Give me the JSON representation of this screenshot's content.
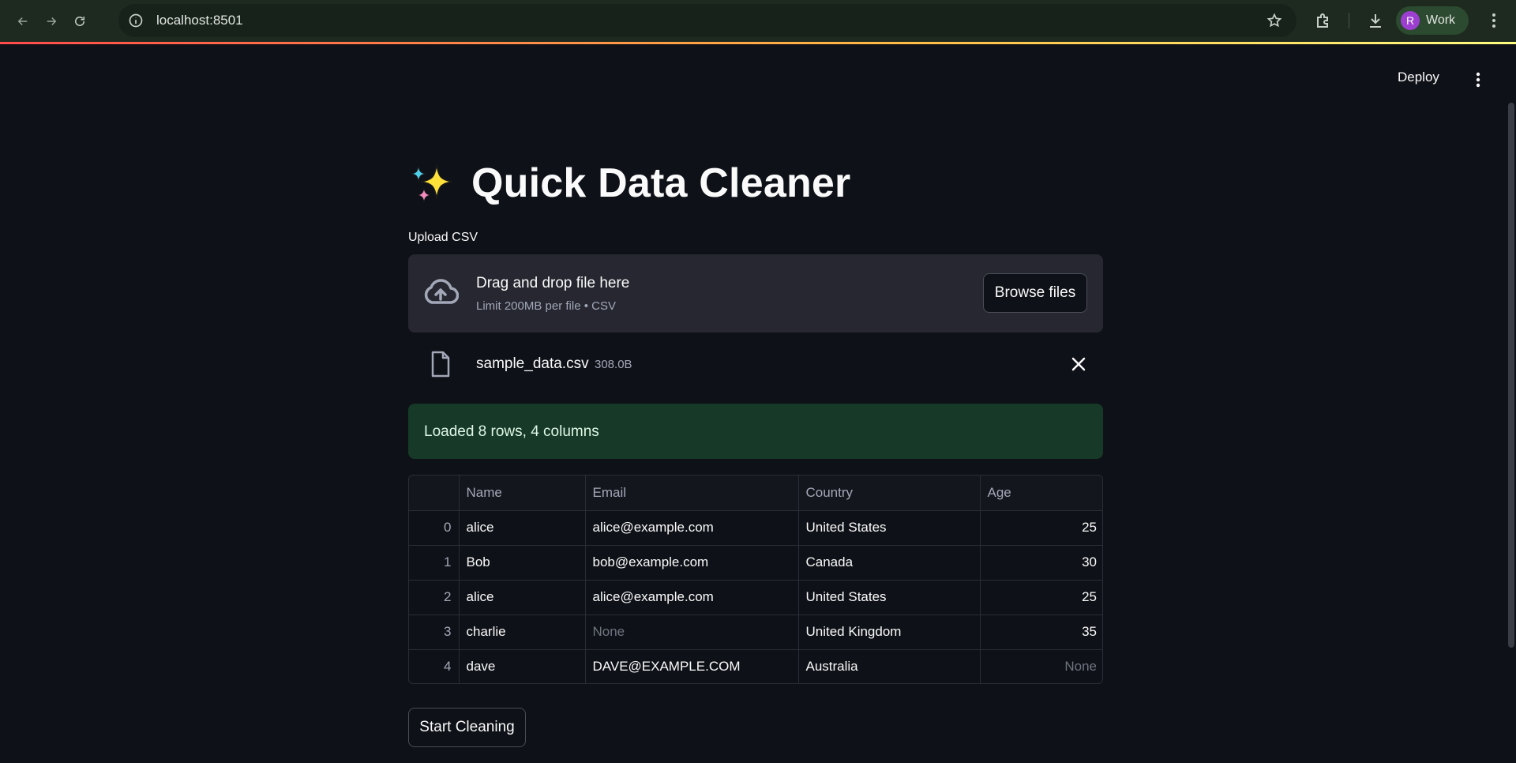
{
  "browser": {
    "url": "localhost:8501",
    "profile_initial": "R",
    "profile_label": "Work"
  },
  "app_header": {
    "deploy_label": "Deploy"
  },
  "title": {
    "text": "Quick Data Cleaner",
    "icon": "sparkles-emoji"
  },
  "uploader": {
    "label": "Upload CSV",
    "drop_text": "Drag and drop file here",
    "limit_text": "Limit 200MB per file • CSV",
    "browse_label": "Browse files",
    "file_name": "sample_data.csv",
    "file_size": "308.0B"
  },
  "status": {
    "message": "Loaded 8 rows, 4 columns",
    "color": "#173928"
  },
  "table": {
    "columns": [
      "",
      "Name",
      "Email",
      "Country",
      "Age"
    ],
    "rows": [
      {
        "index": "0",
        "name": "alice",
        "email": "alice@example.com",
        "country": "United States",
        "age": "25"
      },
      {
        "index": "1",
        "name": "Bob",
        "email": "bob@example.com",
        "country": "Canada",
        "age": "30"
      },
      {
        "index": "2",
        "name": "alice",
        "email": "alice@example.com",
        "country": "United States",
        "age": "25"
      },
      {
        "index": "3",
        "name": "charlie",
        "email": "None",
        "country": "United Kingdom",
        "age": "35"
      },
      {
        "index": "4",
        "name": "dave",
        "email": "DAVE@EXAMPLE.COM",
        "country": "Australia",
        "age": "None"
      }
    ]
  },
  "actions": {
    "start_label": "Start Cleaning"
  }
}
